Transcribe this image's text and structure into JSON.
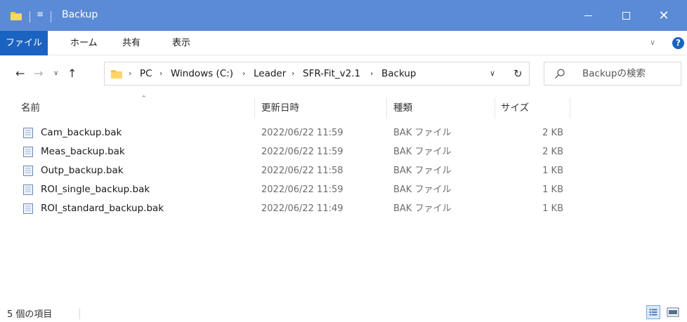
{
  "window": {
    "title": "Backup",
    "qa_glyph": "≡"
  },
  "ribbon": {
    "tabs": [
      {
        "label": "ファイル"
      },
      {
        "label": "ホーム"
      },
      {
        "label": "共有"
      },
      {
        "label": "表示"
      }
    ]
  },
  "address": {
    "crumbs": [
      "PC",
      "Windows (C:)",
      "Leader",
      "SFR-Fit_v2.1",
      "Backup"
    ]
  },
  "search": {
    "placeholder": "Backupの検索"
  },
  "columns": {
    "name": "名前",
    "date": "更新日時",
    "type": "種類",
    "size": "サイズ"
  },
  "files": [
    {
      "name": "Cam_backup.bak",
      "date": "2022/06/22 11:59",
      "type": "BAK ファイル",
      "size": "2 KB"
    },
    {
      "name": "Meas_backup.bak",
      "date": "2022/06/22 11:59",
      "type": "BAK ファイル",
      "size": "2 KB"
    },
    {
      "name": "Outp_backup.bak",
      "date": "2022/06/22 11:58",
      "type": "BAK ファイル",
      "size": "1 KB"
    },
    {
      "name": "ROI_single_backup.bak",
      "date": "2022/06/22 11:59",
      "type": "BAK ファイル",
      "size": "1 KB"
    },
    {
      "name": "ROI_standard_backup.bak",
      "date": "2022/06/22 11:49",
      "type": "BAK ファイル",
      "size": "1 KB"
    }
  ],
  "status": {
    "item_count": "5 個の項目"
  },
  "colors": {
    "titlebar": "#5b8ad6",
    "file_tab": "#1a63c1",
    "folder": "#f4c44f"
  },
  "icons": [
    "folder-icon",
    "back-arrow-icon",
    "forward-arrow-icon",
    "chevron-down-icon",
    "up-arrow-icon",
    "refresh-icon",
    "search-icon",
    "file-icon",
    "details-view-icon",
    "tiles-view-icon",
    "help-icon"
  ]
}
